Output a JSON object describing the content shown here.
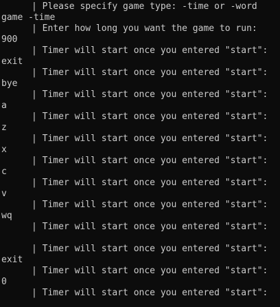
{
  "terminal": {
    "lines": [
      {
        "kind": "prompt",
        "text": "| Please specify game type: -time or -word"
      },
      {
        "kind": "input",
        "text": "game -time"
      },
      {
        "kind": "prompt",
        "text": "| Enter how long you want the game to run:"
      },
      {
        "kind": "input",
        "text": "900"
      },
      {
        "kind": "prompt",
        "text": "| Timer will start once you entered \"start\":"
      },
      {
        "kind": "input",
        "text": "exit"
      },
      {
        "kind": "prompt",
        "text": "| Timer will start once you entered \"start\":"
      },
      {
        "kind": "input",
        "text": "bye"
      },
      {
        "kind": "prompt",
        "text": "| Timer will start once you entered \"start\":"
      },
      {
        "kind": "input",
        "text": "a"
      },
      {
        "kind": "prompt",
        "text": "| Timer will start once you entered \"start\":"
      },
      {
        "kind": "input",
        "text": "z"
      },
      {
        "kind": "prompt",
        "text": "| Timer will start once you entered \"start\":"
      },
      {
        "kind": "input",
        "text": "x"
      },
      {
        "kind": "prompt",
        "text": "| Timer will start once you entered \"start\":"
      },
      {
        "kind": "input",
        "text": "c"
      },
      {
        "kind": "prompt",
        "text": "| Timer will start once you entered \"start\":"
      },
      {
        "kind": "input",
        "text": "v"
      },
      {
        "kind": "prompt",
        "text": "| Timer will start once you entered \"start\":"
      },
      {
        "kind": "input",
        "text": "wq"
      },
      {
        "kind": "prompt",
        "text": "| Timer will start once you entered \"start\":"
      },
      {
        "kind": "input",
        "text": ""
      },
      {
        "kind": "prompt",
        "text": "| Timer will start once you entered \"start\":"
      },
      {
        "kind": "input",
        "text": "exit"
      },
      {
        "kind": "prompt",
        "text": "| Timer will start once you entered \"start\":"
      },
      {
        "kind": "input",
        "text": "0"
      },
      {
        "kind": "prompt",
        "text": "| Timer will start once you entered \"start\":"
      }
    ]
  },
  "colors": {
    "background": "#0c0c0c",
    "foreground": "#cccccc"
  }
}
